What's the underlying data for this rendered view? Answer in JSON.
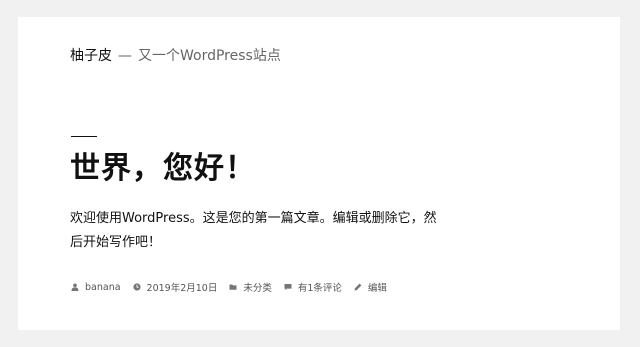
{
  "site": {
    "title": "柚子皮",
    "separator": "—",
    "description": "又一个WordPress站点"
  },
  "post": {
    "title": "世界，您好！",
    "content": "欢迎使用WordPress。这是您的第一篇文章。编辑或删除它，然后开始写作吧！"
  },
  "meta": {
    "author": "banana",
    "date": "2019年2月10日",
    "category": "未分类",
    "comments": "有1条评论",
    "edit": "编辑"
  },
  "icons": {
    "author": "user-icon",
    "date": "clock-icon",
    "category": "folder-icon",
    "comments": "comment-icon",
    "edit": "pencil-icon"
  }
}
